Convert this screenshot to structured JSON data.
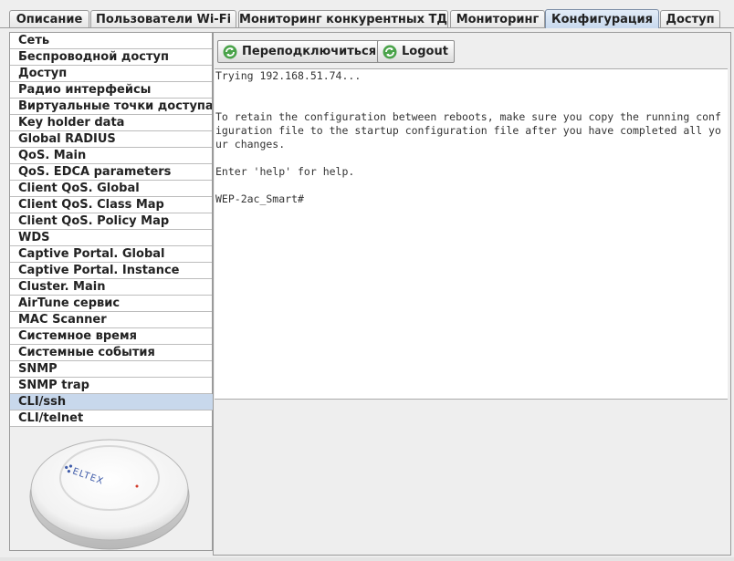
{
  "tabs": [
    {
      "label": "Описание"
    },
    {
      "label": "Пользователи Wi-Fi"
    },
    {
      "label": "Мониторинг конкурентных ТД"
    },
    {
      "label": "Мониторинг"
    },
    {
      "label": "Конфигурация",
      "active": true
    },
    {
      "label": "Доступ"
    }
  ],
  "menu": [
    {
      "label": "Сеть"
    },
    {
      "label": "Беспроводной доступ"
    },
    {
      "label": "Доступ"
    },
    {
      "label": "Радио интерфейсы"
    },
    {
      "label": "Виртуальные точки доступа"
    },
    {
      "label": "Key holder data"
    },
    {
      "label": "Global RADIUS"
    },
    {
      "label": "QoS. Main"
    },
    {
      "label": "QoS. EDCA parameters"
    },
    {
      "label": "Client QoS. Global"
    },
    {
      "label": "Client QoS. Class Map"
    },
    {
      "label": "Client QoS. Policy Map"
    },
    {
      "label": "WDS"
    },
    {
      "label": "Captive Portal. Global"
    },
    {
      "label": "Captive Portal. Instance"
    },
    {
      "label": "Cluster. Main"
    },
    {
      "label": "AirTune сервис"
    },
    {
      "label": "MAC Scanner"
    },
    {
      "label": "Системное время"
    },
    {
      "label": "Системные события"
    },
    {
      "label": "SNMP"
    },
    {
      "label": "SNMP trap"
    },
    {
      "label": "CLI/ssh",
      "selected": true
    },
    {
      "label": "CLI/telnet"
    }
  ],
  "device": {
    "brand": "ELTEX"
  },
  "toolbar": {
    "reconnect_label": "Переподключиться",
    "logout_label": "Logout",
    "icon": "refresh-icon"
  },
  "terminal": {
    "lines": [
      "Trying 192.168.51.74...",
      "",
      "",
      "To retain the configuration between reboots, make sure you copy the running conf",
      "iguration file to the startup configuration file after you have completed all yo",
      "ur changes.",
      "",
      "Enter 'help' for help.",
      "",
      "WEP-2ac_Smart#"
    ]
  },
  "colors": {
    "active_tab": "#c8d9ee",
    "selected_item": "#c8d8ec",
    "icon_green": "#3a9a3a"
  }
}
